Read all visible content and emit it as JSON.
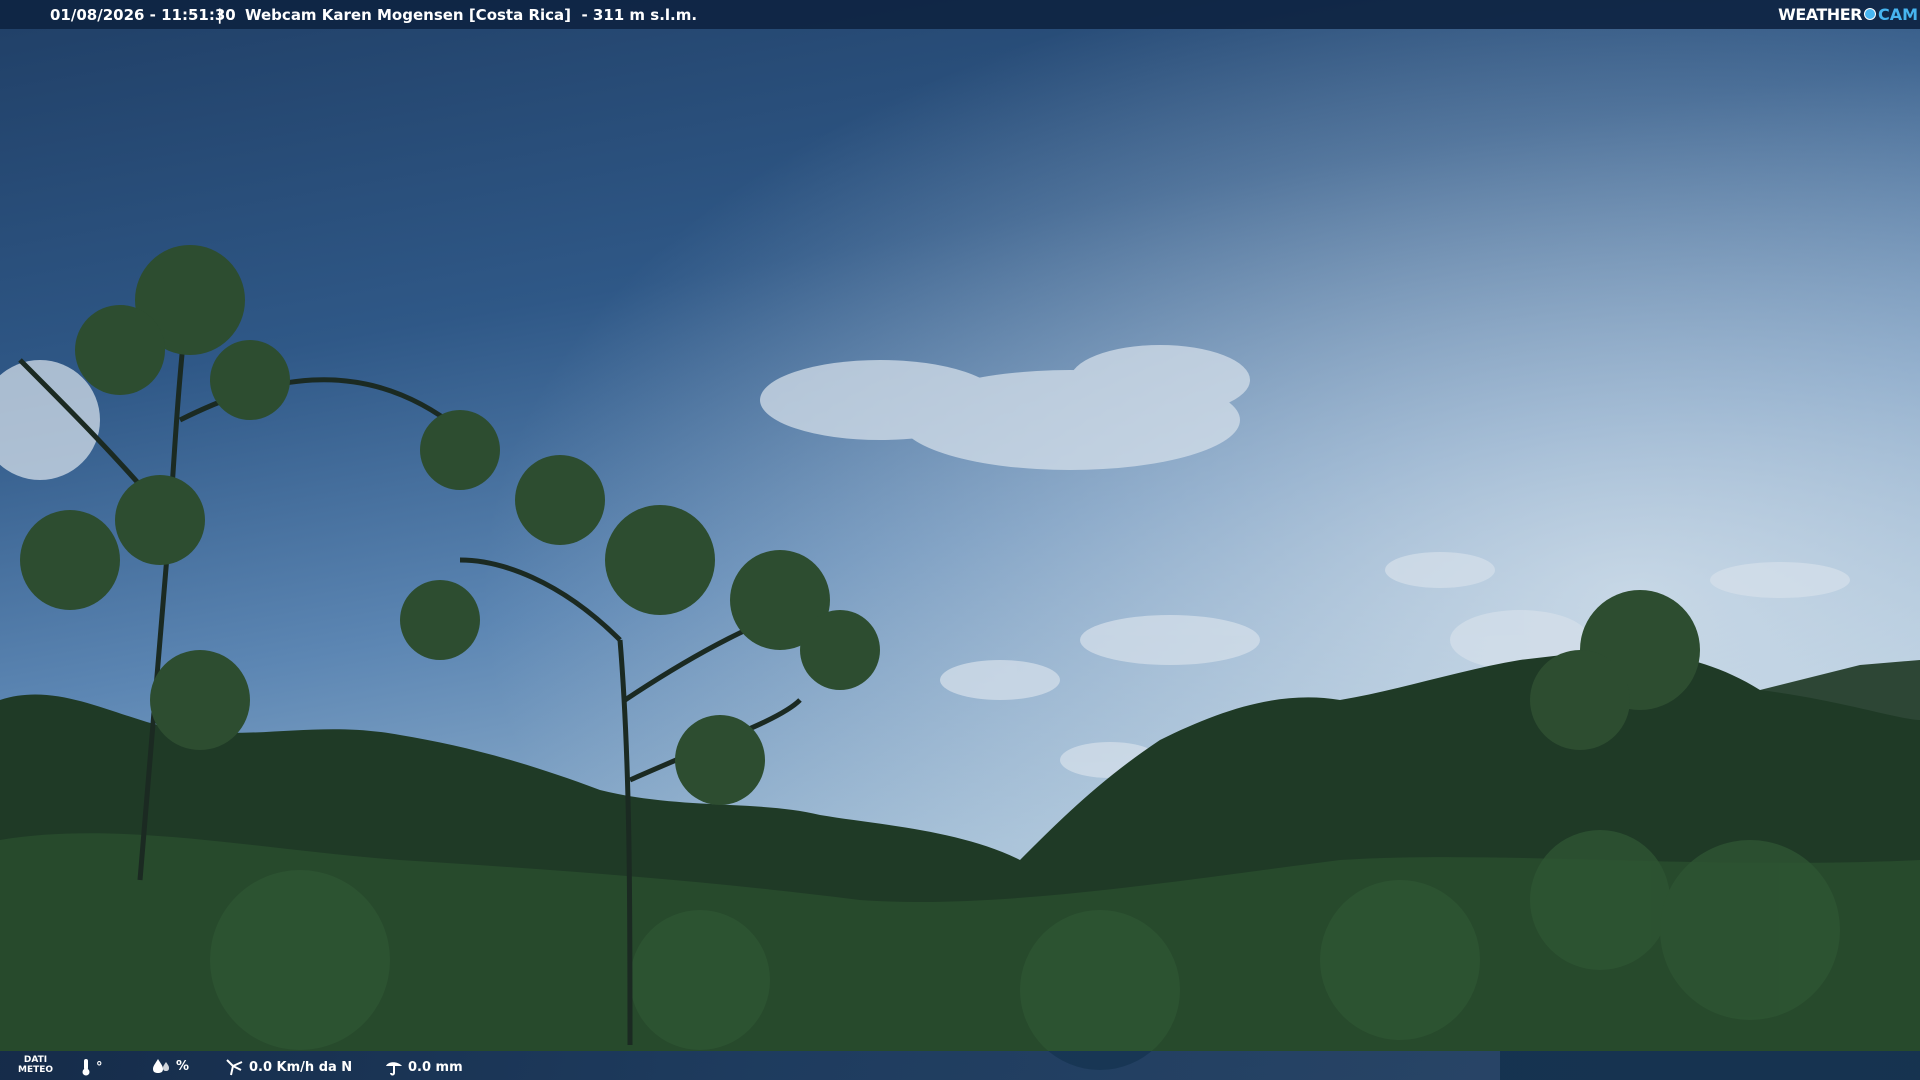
{
  "header": {
    "datetime": "01/08/2026 - 11:51:30",
    "separator": "|",
    "title": "Webcam Karen Mogensen [Costa Rica]  - 311 m s.l.m.",
    "logo": {
      "weather": "WEATHER",
      "cam": "CAM"
    }
  },
  "footer": {
    "meteo_label_line1": "DATI",
    "meteo_label_line2": "METEO",
    "temperature": "°",
    "humidity": "%",
    "wind": "0.0 Km/h da N",
    "rain": "0.0 mm"
  },
  "icons": {
    "temperature": "thermometer-icon",
    "humidity": "humidity-drop-icon",
    "wind": "wind-icon",
    "rain": "rain-gauge-icon"
  },
  "colors": {
    "bar_background": "#0e2442",
    "logo_accent": "#47b5f0",
    "text": "#ffffff"
  }
}
